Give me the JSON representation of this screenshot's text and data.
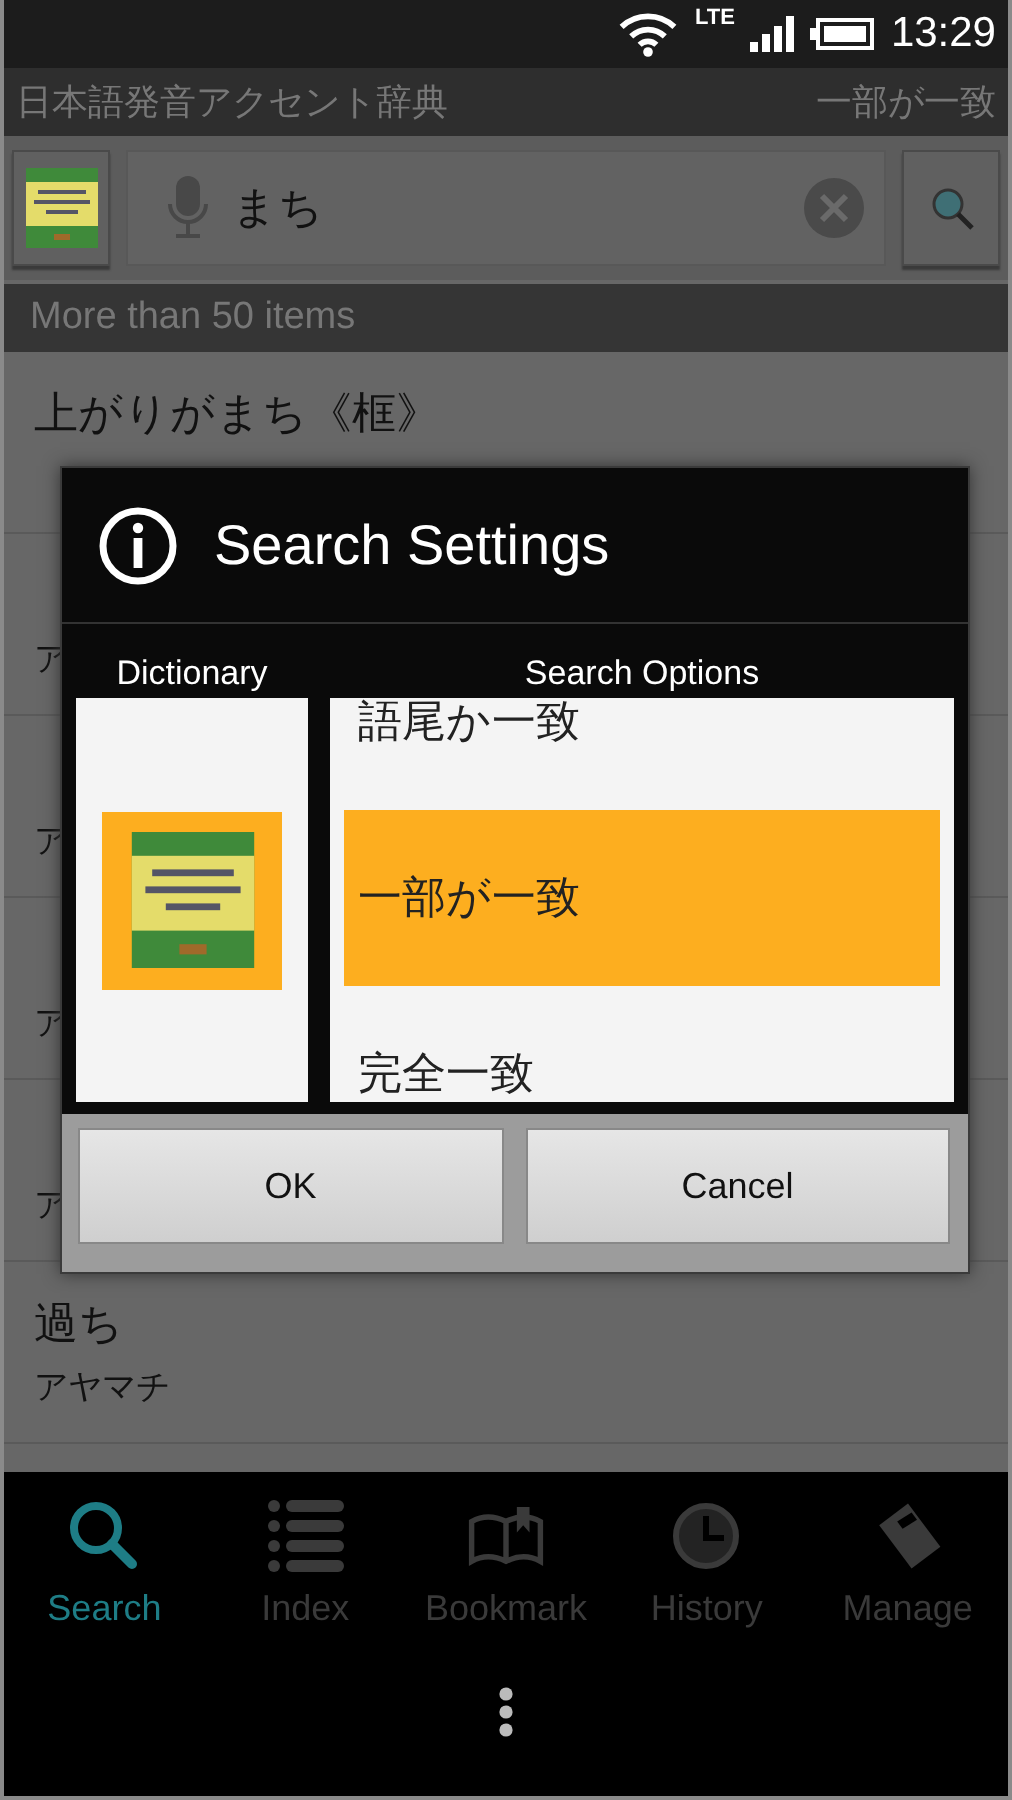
{
  "status_bar": {
    "network": "LTE",
    "time": "13:29"
  },
  "app_bar": {
    "title": "日本語発音アクセント辞典",
    "mode": "一部が一致"
  },
  "search": {
    "value": "まち"
  },
  "results": {
    "header": "More than 50 items",
    "rows": [
      {
        "title": "上がりがまち《框》"
      },
      {
        "reading": "ア"
      },
      {
        "reading": "ア"
      },
      {
        "reading": "ア"
      },
      {
        "reading": "ア"
      },
      {
        "title": "過ち",
        "reading": "アヤマチ"
      }
    ]
  },
  "dialog": {
    "title": "Search Settings",
    "dictionary_label": "Dictionary",
    "options_label": "Search Options",
    "dictionaries": [
      {
        "selected": true
      }
    ],
    "options": [
      {
        "label": "語尾か一致",
        "selected": false
      },
      {
        "label": "一部が一致",
        "selected": true
      },
      {
        "label": "完全一致",
        "selected": false
      }
    ],
    "buttons": [
      "OK",
      "Cancel"
    ]
  },
  "nav": [
    {
      "label": "Search",
      "kind": "search",
      "selected": true
    },
    {
      "label": "Index",
      "kind": "index",
      "selected": false
    },
    {
      "label": "Bookmark",
      "kind": "bookmark",
      "selected": false
    },
    {
      "label": "History",
      "kind": "history",
      "selected": false
    },
    {
      "label": "Manage",
      "kind": "manage",
      "selected": false
    }
  ]
}
